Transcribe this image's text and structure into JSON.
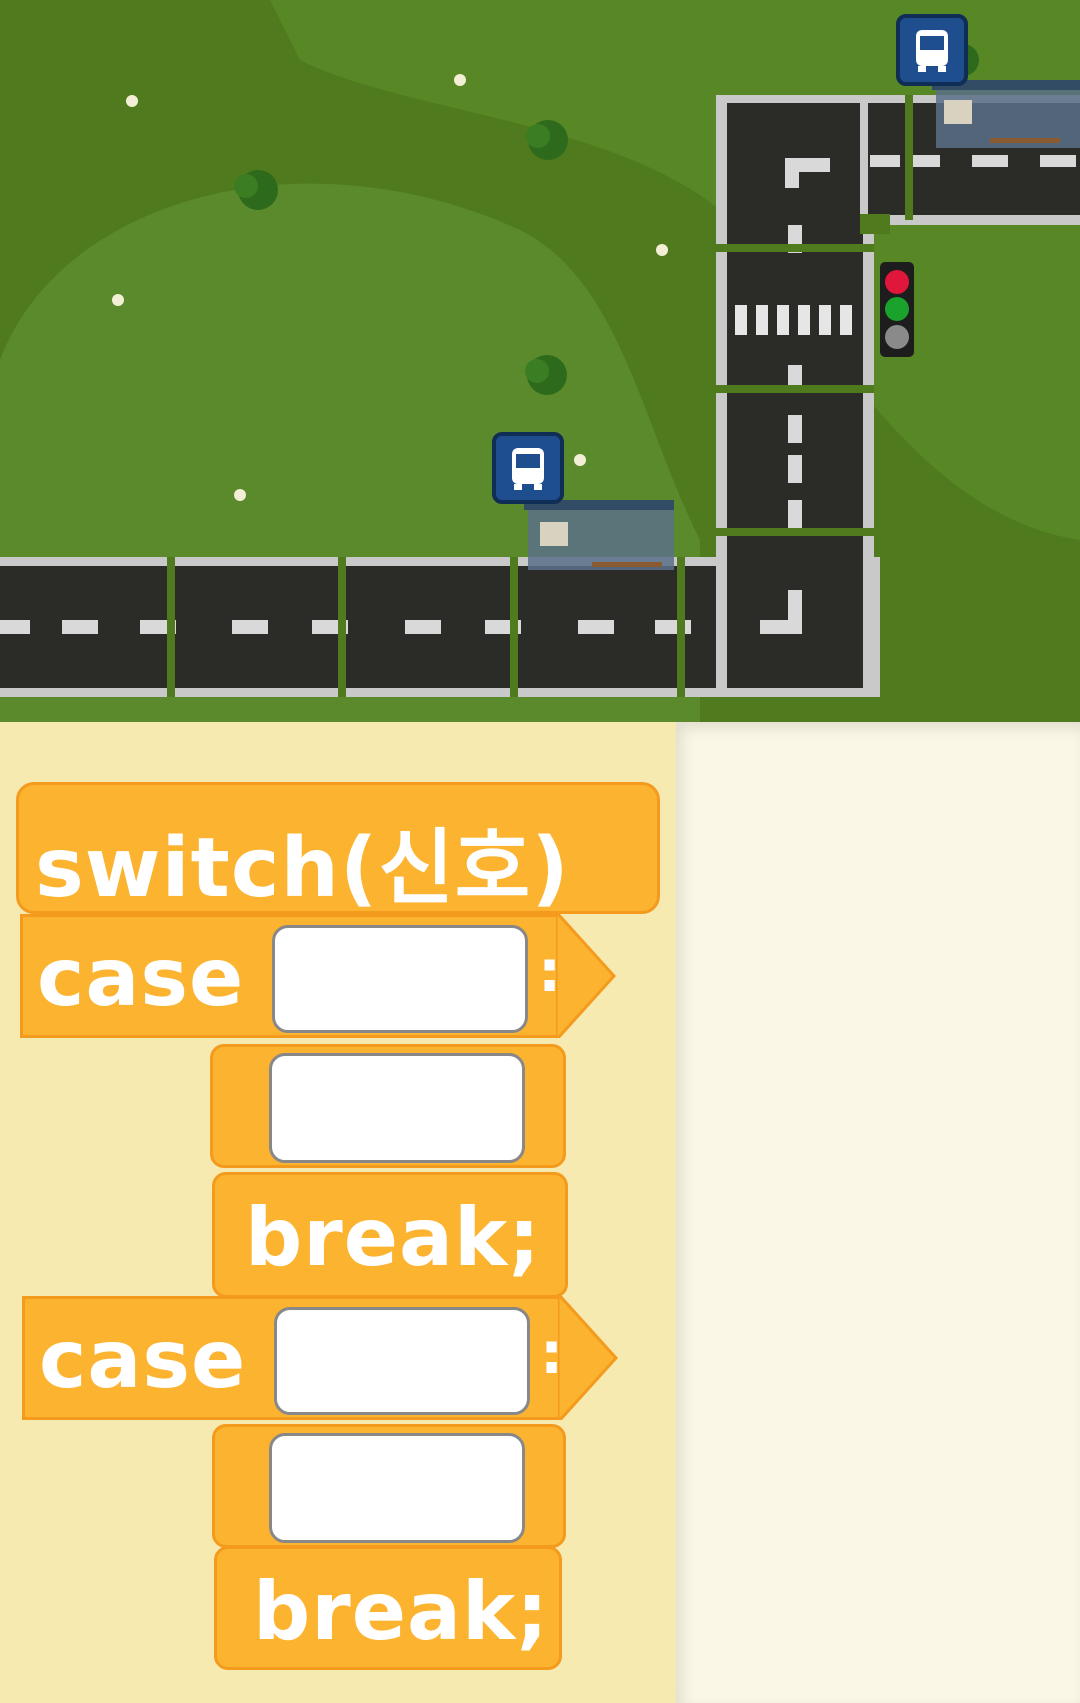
{
  "map": {
    "bus_stop_icons": [
      "bus-stop-icon",
      "bus-stop-icon"
    ],
    "traffic_light": {
      "lights": [
        "red",
        "green",
        "off"
      ]
    }
  },
  "blocks": {
    "switch_label": "switch(신호)",
    "cases": [
      {
        "label": "case",
        "colon": ":",
        "break_label": "break;"
      },
      {
        "label": "case",
        "colon": ":",
        "break_label": "break;"
      }
    ]
  },
  "colors": {
    "grass": "#4f7a1e",
    "grass_light": "#5b8a2c",
    "road": "#2b2b28",
    "block_fill": "#fcb330",
    "block_border": "#f49a1c",
    "palette_bg": "#f6eab0",
    "workspace_bg": "#fbf7e6",
    "bus_stop_icon": "#1f4e8f"
  }
}
